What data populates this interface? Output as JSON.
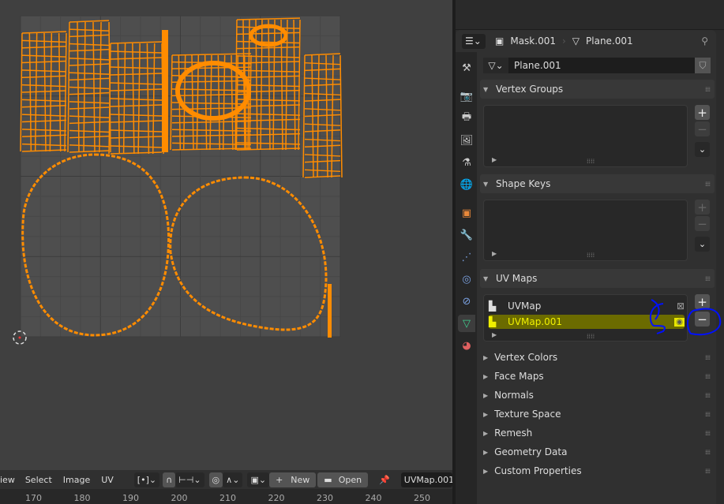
{
  "uv_editor": {
    "menu": [
      "iew",
      "Select",
      "Image",
      "UV"
    ],
    "new_label": "New",
    "open_label": "Open",
    "uv_map_field": "UVMap.001",
    "ruler_ticks": [
      "170",
      "180",
      "190",
      "200",
      "210",
      "220",
      "230",
      "240",
      "250"
    ],
    "mesh_color": "#ff8c00"
  },
  "properties": {
    "breadcrumb": {
      "object": "Mask.001",
      "mesh": "Plane.001"
    },
    "mesh_datablock": "Plane.001",
    "tabs": [
      "tool",
      "render",
      "output",
      "view-layer",
      "scene",
      "world",
      "object",
      "modifiers",
      "particles",
      "physics",
      "constraints",
      "object-data",
      "material"
    ],
    "active_tab": "object-data",
    "panels": {
      "vertex_groups": "Vertex Groups",
      "shape_keys": "Shape Keys",
      "uv_maps": "UV Maps"
    },
    "uv_maps": [
      {
        "name": "UVMap",
        "active_render": false,
        "selected": false
      },
      {
        "name": "UVMap.001",
        "active_render": true,
        "selected": true
      }
    ],
    "collapsed_panels": [
      "Vertex Colors",
      "Face Maps",
      "Normals",
      "Texture Space",
      "Remesh",
      "Geometry Data",
      "Custom Properties"
    ],
    "highlight_color": "#6b6b00",
    "annotation_color": "#0010ff"
  }
}
